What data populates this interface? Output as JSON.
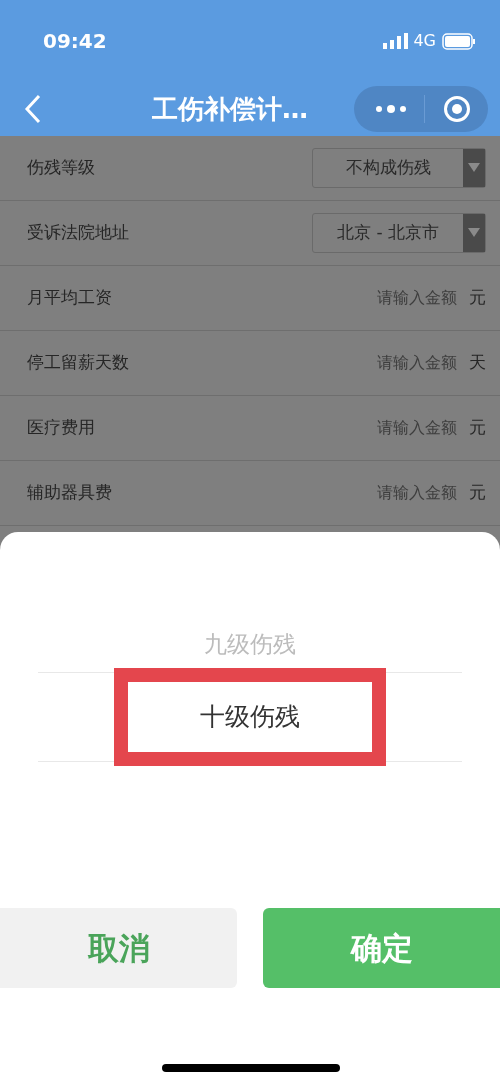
{
  "status_bar": {
    "time": "09:42",
    "network": "4G"
  },
  "nav": {
    "title": "工伤补偿计…"
  },
  "form_rows": [
    {
      "kind": "select",
      "label": "伤残等级",
      "value": "不构成伤残"
    },
    {
      "kind": "select",
      "label": "受诉法院地址",
      "value": "北京 - 北京市"
    },
    {
      "kind": "input",
      "label": "月平均工资",
      "placeholder": "请输入金额",
      "unit": "元"
    },
    {
      "kind": "input",
      "label": "停工留薪天数",
      "placeholder": "请输入金额",
      "unit": "天"
    },
    {
      "kind": "input",
      "label": "医疗费用",
      "placeholder": "请输入金额",
      "unit": "元"
    },
    {
      "kind": "input",
      "label": "辅助器具费",
      "placeholder": "请输入金额",
      "unit": "元"
    }
  ],
  "picker": {
    "options": [
      {
        "label": "九级伤残",
        "selected": false
      },
      {
        "label": "十级伤残",
        "selected": true
      }
    ],
    "buttons": [
      {
        "kind": "cancel",
        "label": "取消"
      },
      {
        "kind": "confirm",
        "label": "确定"
      }
    ]
  }
}
